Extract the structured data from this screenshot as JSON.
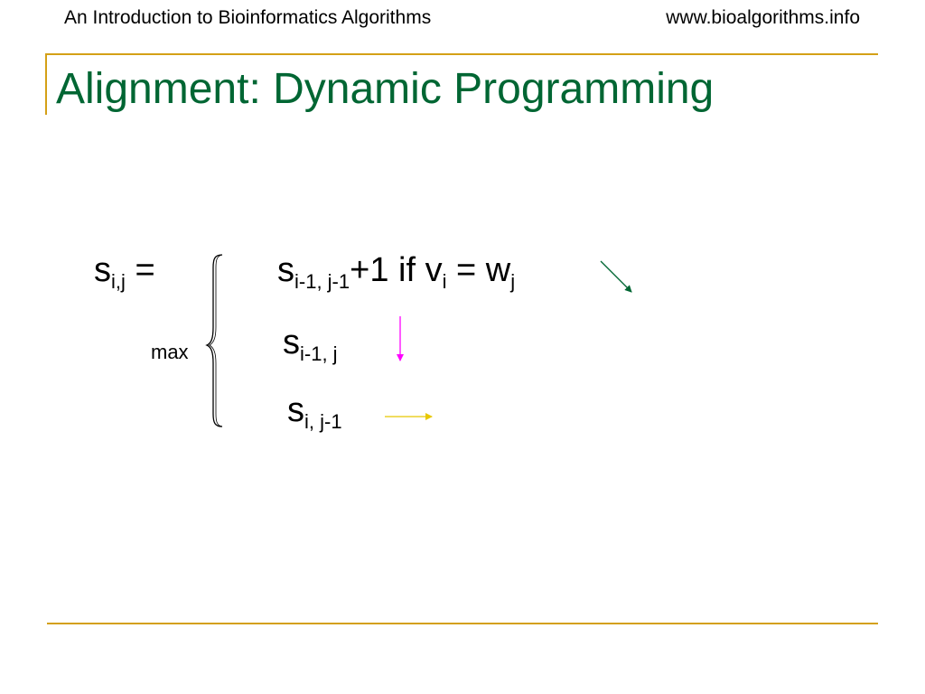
{
  "header": {
    "left": "An Introduction to Bioinformatics Algorithms",
    "right": "www.bioalgorithms.info"
  },
  "title": "Alignment: Dynamic Programming",
  "colors": {
    "rule": "#d4a017",
    "title": "#006633",
    "diag_arrow": "#006633",
    "down_arrow": "#ff00ff",
    "right_arrow": "#e8c800"
  },
  "formula": {
    "lhs_var": "s",
    "lhs_sub": "i,j",
    "equals": " =",
    "max": "max",
    "case1_var": "s",
    "case1_sub": "i-1, j-1",
    "case1_plus": "+1 if v",
    "case1_vsub": "i",
    "case1_eq": " = w",
    "case1_wsub": "j",
    "case2_var": "s",
    "case2_sub": "i-1, j",
    "case3_var": "s",
    "case3_sub": "i, j-1"
  },
  "icons": {
    "brace": "left-curly-brace",
    "diag": "diagonal-arrow-icon",
    "down": "down-arrow-icon",
    "right": "right-arrow-icon"
  }
}
